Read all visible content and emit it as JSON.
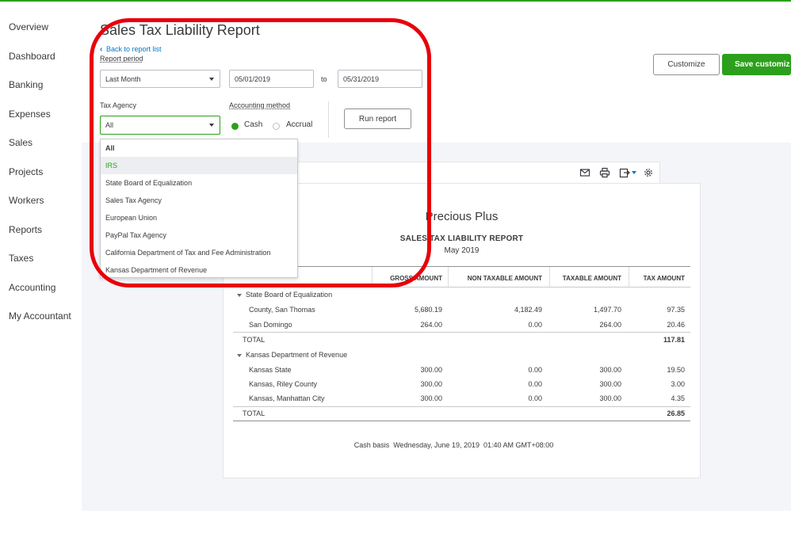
{
  "sidebar": {
    "items": [
      "Overview",
      "Dashboard",
      "Banking",
      "Expenses",
      "Sales",
      "Projects",
      "Workers",
      "Reports",
      "Taxes",
      "Accounting",
      "My Accountant"
    ]
  },
  "page": {
    "title": "Sales Tax Liability Report",
    "back_link": "Back to report list"
  },
  "filters": {
    "report_period_label": "Report period",
    "report_period_value": "Last Month",
    "date_from": "05/01/2019",
    "to_label": "to",
    "date_to": "05/31/2019",
    "tax_agency_label": "Tax Agency",
    "tax_agency_value": "All",
    "accounting_method_label": "Accounting method",
    "method_cash": "Cash",
    "method_accrual": "Accrual",
    "selected_method": "Cash",
    "run_report_label": "Run report"
  },
  "toolbar": {
    "customize_label": "Customize",
    "save_label": "Save customization"
  },
  "tax_agency_dropdown": {
    "options": [
      "All",
      "IRS",
      "State Board of Equalization",
      "Sales Tax Agency",
      "European Union",
      "PayPal Tax Agency",
      "California Department of Tax and Fee Administration",
      "Kansas Department of Revenue"
    ],
    "highlighted": "IRS"
  },
  "report": {
    "company": "Precious Plus",
    "title": "SALES TAX LIABILITY REPORT",
    "period": "May 2019",
    "columns": [
      "GROSS AMOUNT",
      "NON TAXABLE AMOUNT",
      "TAXABLE AMOUNT",
      "TAX AMOUNT"
    ],
    "groups": [
      {
        "name": "State Board of Equalization",
        "rows": [
          {
            "name": "County, San Thomas",
            "gross": "5,680.19",
            "non_taxable": "4,182.49",
            "taxable": "1,497.70",
            "tax": "97.35"
          },
          {
            "name": "San Domingo",
            "gross": "264.00",
            "non_taxable": "0.00",
            "taxable": "264.00",
            "tax": "20.46"
          }
        ],
        "total_label": "TOTAL",
        "total_tax": "117.81"
      },
      {
        "name": "Kansas Department of Revenue",
        "rows": [
          {
            "name": "Kansas State",
            "gross": "300.00",
            "non_taxable": "0.00",
            "taxable": "300.00",
            "tax": "19.50"
          },
          {
            "name": "Kansas, Riley County",
            "gross": "300.00",
            "non_taxable": "0.00",
            "taxable": "300.00",
            "tax": "3.00"
          },
          {
            "name": "Kansas, Manhattan City",
            "gross": "300.00",
            "non_taxable": "0.00",
            "taxable": "300.00",
            "tax": "4.35"
          }
        ],
        "total_label": "TOTAL",
        "total_tax": "26.85"
      }
    ],
    "footer": "Cash basis  Wednesday, June 19, 2019  01:40 AM GMT+08:00"
  },
  "report_tools": [
    "email-icon",
    "print-icon",
    "export-icon",
    "settings-icon"
  ],
  "colors": {
    "accent_green": "#2ca01c",
    "link_blue": "#0077c5",
    "annotation_red": "#e8000b"
  }
}
